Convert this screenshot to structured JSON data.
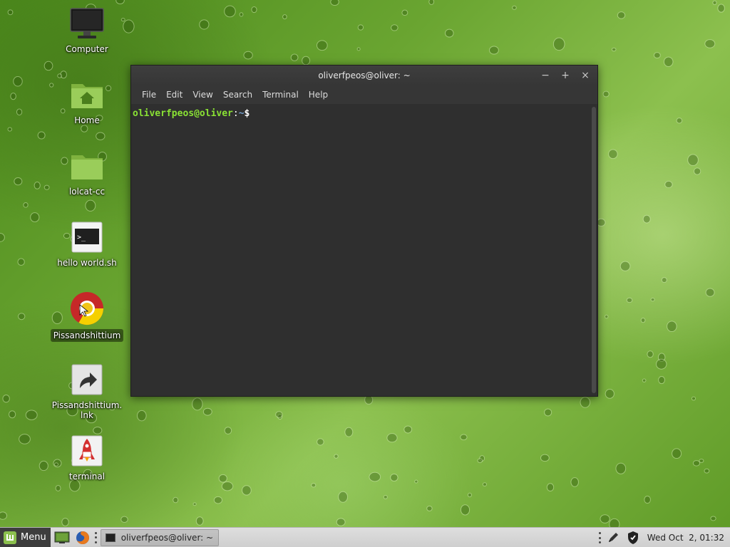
{
  "desktop": {
    "icons": [
      {
        "label": "Computer",
        "icon": "monitor-icon"
      },
      {
        "label": "Home",
        "icon": "home-folder-icon"
      },
      {
        "label": "lolcat-cc",
        "icon": "folder-icon"
      },
      {
        "label": "hello world.sh",
        "icon": "terminal-script-icon"
      },
      {
        "label": "Pissandshittium",
        "icon": "chromium-browser-icon",
        "selected": true
      },
      {
        "label": "Pissandshittium.\nlnk",
        "icon": "shortcut-arrow-icon"
      },
      {
        "label": "terminal",
        "icon": "rocket-icon"
      }
    ]
  },
  "terminal": {
    "title": "oliverfpeos@oliver: ~",
    "controls": {
      "minimize": "−",
      "maximize": "+",
      "close": "×"
    },
    "menu": [
      "File",
      "Edit",
      "View",
      "Search",
      "Terminal",
      "Help"
    ],
    "prompt": {
      "user_host": "oliverfpeos@oliver",
      "separator": ":",
      "path": "~",
      "symbol": "$"
    }
  },
  "taskbar": {
    "menu_label": "Menu",
    "launchers": [
      "show-desktop-icon",
      "firefox-icon"
    ],
    "windows": [
      {
        "label": "oliverfpeos@oliver: ~",
        "icon": "terminal-icon"
      }
    ],
    "tray": [
      "pen-icon",
      "shield-icon"
    ],
    "clock": "Wed Oct  2, 01:32"
  },
  "colors": {
    "prompt_user": "#8ae234",
    "prompt_path": "#729fcf",
    "terminal_bg": "#2f2f2f"
  }
}
